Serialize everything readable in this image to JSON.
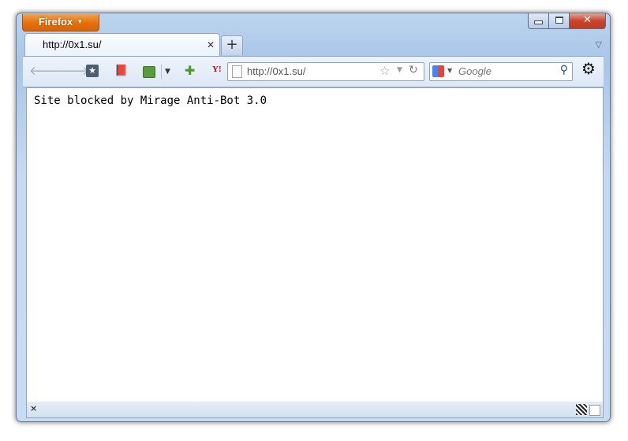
{
  "window": {
    "app_button_label": "Firefox",
    "close_glyph": "✕"
  },
  "tab": {
    "title": "http://0x1.su/",
    "close_glyph": "✕"
  },
  "new_tab_glyph": "+",
  "toolbar": {
    "back_icon": "back-arrow-icon",
    "forward_icon": "forward-arrow-icon",
    "yahoo_label": "Y!"
  },
  "urlbar": {
    "value": "http://0x1.su/"
  },
  "searchbar": {
    "placeholder": "Google",
    "engine_icon": "google-icon"
  },
  "content": {
    "message": "Site blocked by Mirage Anti-Bot 3.0"
  },
  "statusbar": {
    "close_glyph": "×"
  },
  "colors": {
    "firefox_button": "#e3700b",
    "frame": "#c6daf1",
    "close_button": "#c8452c"
  }
}
